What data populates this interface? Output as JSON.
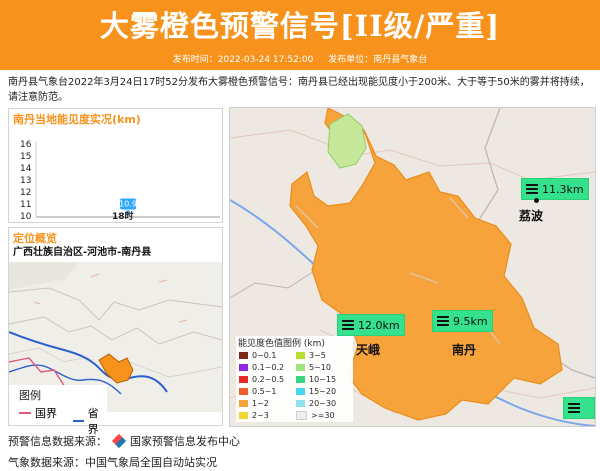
{
  "header": {
    "title": "大雾橙色预警信号[II级/严重]",
    "publish_time_label": "发布时间：2022-03-24 17:52:00",
    "publisher_label": "发布单位：南丹县气象台"
  },
  "description": "南丹县气象台2022年3月24日17时52分发布大雾橙色预警信号：南丹县已经出现能见度小于200米、大于等于50米的雾并将持续，请注意防范。",
  "visibility_panel": {
    "title": "南丹当地能见度实况(km)",
    "chart_data": {
      "type": "scatter",
      "categories": [
        "18时"
      ],
      "values": [
        10.9
      ],
      "data_labels": [
        "10.9"
      ],
      "yticks": [
        "16",
        "15",
        "14",
        "13",
        "12",
        "11",
        "10"
      ],
      "ylim": [
        10,
        16
      ]
    }
  },
  "location_panel": {
    "title": "定位概览",
    "path": "广西壮族自治区-河池市-南丹县",
    "legend_title": "图例",
    "legend_items": [
      {
        "label": "国界",
        "color": "#e05a7a"
      },
      {
        "label": "省界",
        "color": "#2a5fd0"
      }
    ]
  },
  "map": {
    "stations": [
      {
        "label": "11.3km"
      },
      {
        "label": "12.0km"
      },
      {
        "label": "9.5km"
      }
    ],
    "places": [
      "荔波",
      "天峨",
      "南丹"
    ],
    "legend": {
      "title": "能见度色值图例 (km)",
      "items": [
        {
          "label": "0~0.1",
          "color": "#7a1f0f"
        },
        {
          "label": "3~5",
          "color": "#b7df2c"
        },
        {
          "label": "0.1~0.2",
          "color": "#8a1fe6"
        },
        {
          "label": "5~10",
          "color": "#9ce57a"
        },
        {
          "label": "0.2~0.5",
          "color": "#e8231e"
        },
        {
          "label": "10~15",
          "color": "#31d77a"
        },
        {
          "label": "0.5~1",
          "color": "#f25a24"
        },
        {
          "label": "15~20",
          "color": "#40d7f0"
        },
        {
          "label": "1~2",
          "color": "#f7a135"
        },
        {
          "label": "20~30",
          "color": "#8fe1ef"
        },
        {
          "label": "2~3",
          "color": "#f0d72a"
        },
        {
          "label": ">=30",
          "color": "#efefef"
        }
      ]
    },
    "colors": {
      "fog_area": "#f7a33c",
      "green_area": "#c7e89a"
    }
  },
  "footer": {
    "source_warning": "预警信息数据来源：",
    "source_warning_org": "国家预警信息发布中心",
    "source_weather": "气象数据来源：中国气象局全国自动站实况"
  }
}
